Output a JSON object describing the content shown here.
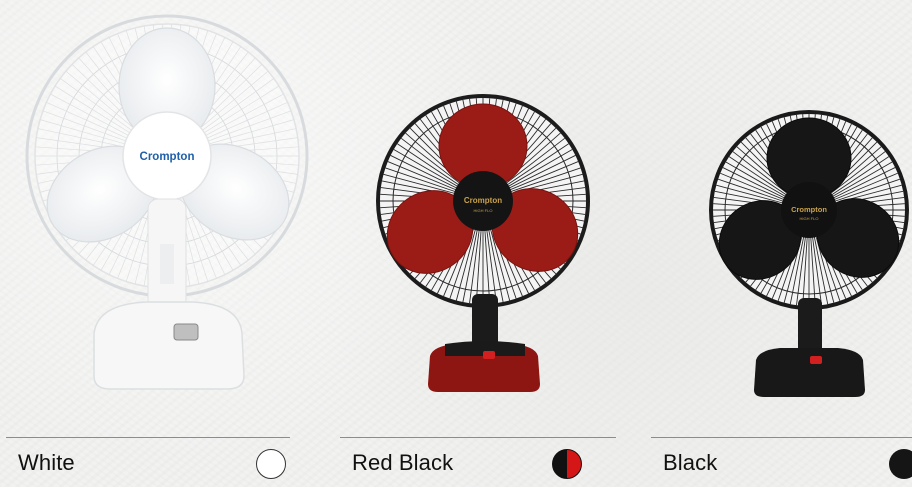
{
  "brand": "Crompton",
  "model_badge": "HIGH FLO",
  "colors": {
    "white_body": "#f7f7f7",
    "red_blade": "#9b1c17",
    "black_body": "#161616",
    "swatch_red": "#d41616"
  },
  "options": [
    {
      "label": "White",
      "swatch": "white-swatch"
    },
    {
      "label": "Red Black",
      "swatch": "red-black-swatch"
    },
    {
      "label": "Black",
      "swatch": "black-swatch"
    }
  ]
}
